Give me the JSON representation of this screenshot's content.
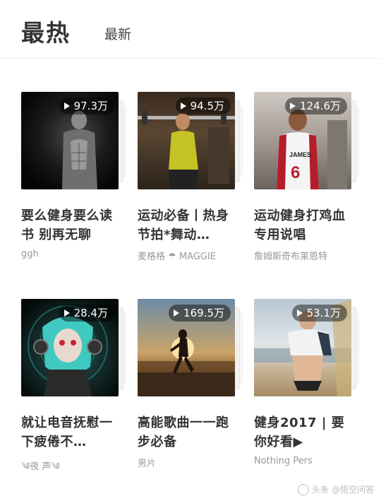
{
  "tabs": {
    "hot": "最热",
    "new": "最新"
  },
  "cards": [
    {
      "count": "97.3万",
      "title": "要么健身要么读书 别再无聊",
      "author": "ggh",
      "cover": "muscular-man-black-background"
    },
    {
      "count": "94.5万",
      "title": "运动必备丨热身节拍*舞动…",
      "author": "麦格格 ☂ MAGGIE",
      "cover": "woman-lifting-barbell"
    },
    {
      "count": "124.6万",
      "title": "运动健身打鸡血专用说唱",
      "author": "詹姆斯奇布莱恩特",
      "cover": "basketball-player-james-6"
    },
    {
      "count": "28.4万",
      "title": "就让电音抚慰一下疲倦不…",
      "author": "༄夜 声༄",
      "cover": "anime-headphones-girl"
    },
    {
      "count": "169.5万",
      "title": "高能歌曲一一跑步必备",
      "author": "男片",
      "cover": "runner-sunset"
    },
    {
      "count": "53.1万",
      "title": "健身2017 | 要你好看▶",
      "author": "Nothing Pers",
      "cover": "woman-beach-fitness"
    }
  ],
  "watermark": "头条 @悟空问答"
}
